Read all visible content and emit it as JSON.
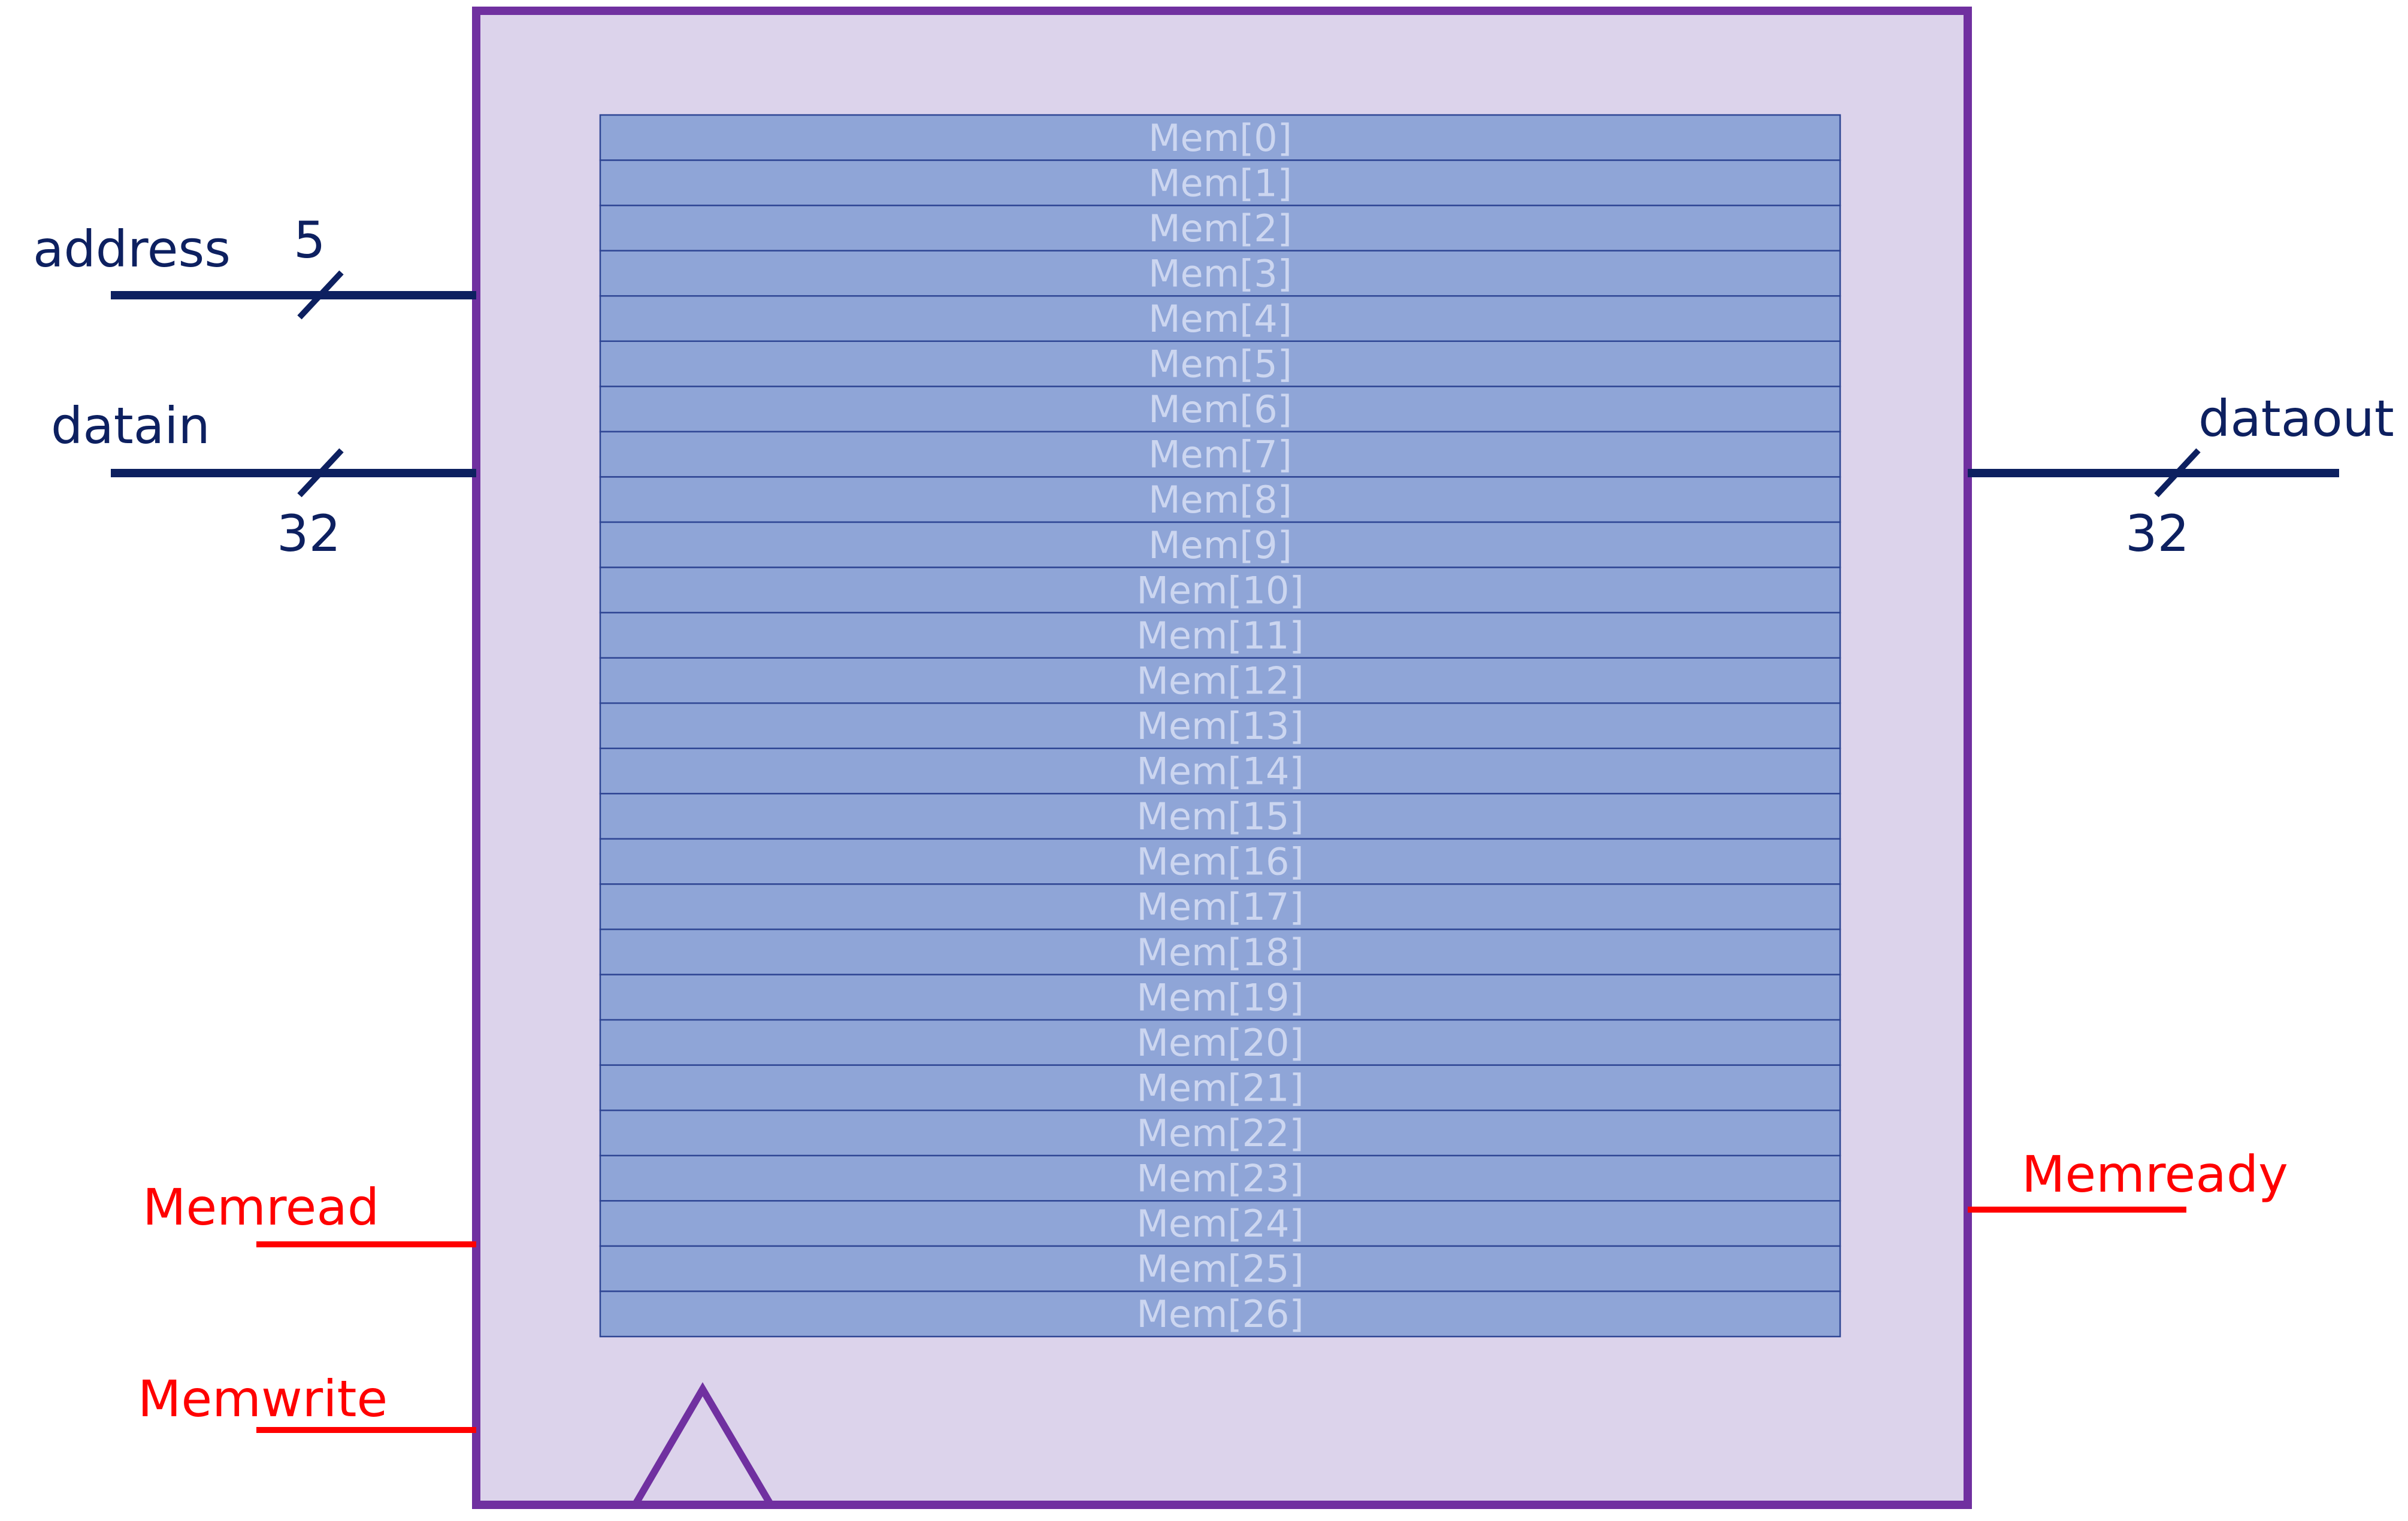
{
  "colors": {
    "block_fill": "#dcd3eb",
    "block_stroke": "#7030a0",
    "cell_fill": "#8fa5d7",
    "cell_stroke": "#2f4694",
    "cell_text": "#ccd6f0",
    "data_signal": "#0d2060",
    "control_signal": "#ff0000"
  },
  "memory": {
    "cells": [
      "Mem[0]",
      "Mem[1]",
      "Mem[2]",
      "Mem[3]",
      "Mem[4]",
      "Mem[5]",
      "Mem[6]",
      "Mem[7]",
      "Mem[8]",
      "Mem[9]",
      "Mem[10]",
      "Mem[11]",
      "Mem[12]",
      "Mem[13]",
      "Mem[14]",
      "Mem[15]",
      "Mem[16]",
      "Mem[17]",
      "Mem[18]",
      "Mem[19]",
      "Mem[20]",
      "Mem[21]",
      "Mem[22]",
      "Mem[23]",
      "Mem[24]",
      "Mem[25]",
      "Mem[26]"
    ]
  },
  "signals": {
    "address": {
      "label": "address",
      "width": "5"
    },
    "datain": {
      "label": "datain",
      "width": "32"
    },
    "dataout": {
      "label": "dataout",
      "width": "32"
    },
    "memread": {
      "label": "Memread"
    },
    "memwrite": {
      "label": "Memwrite"
    },
    "memready": {
      "label": "Memready"
    }
  },
  "icons": {
    "clock": "clock-triangle-icon"
  }
}
